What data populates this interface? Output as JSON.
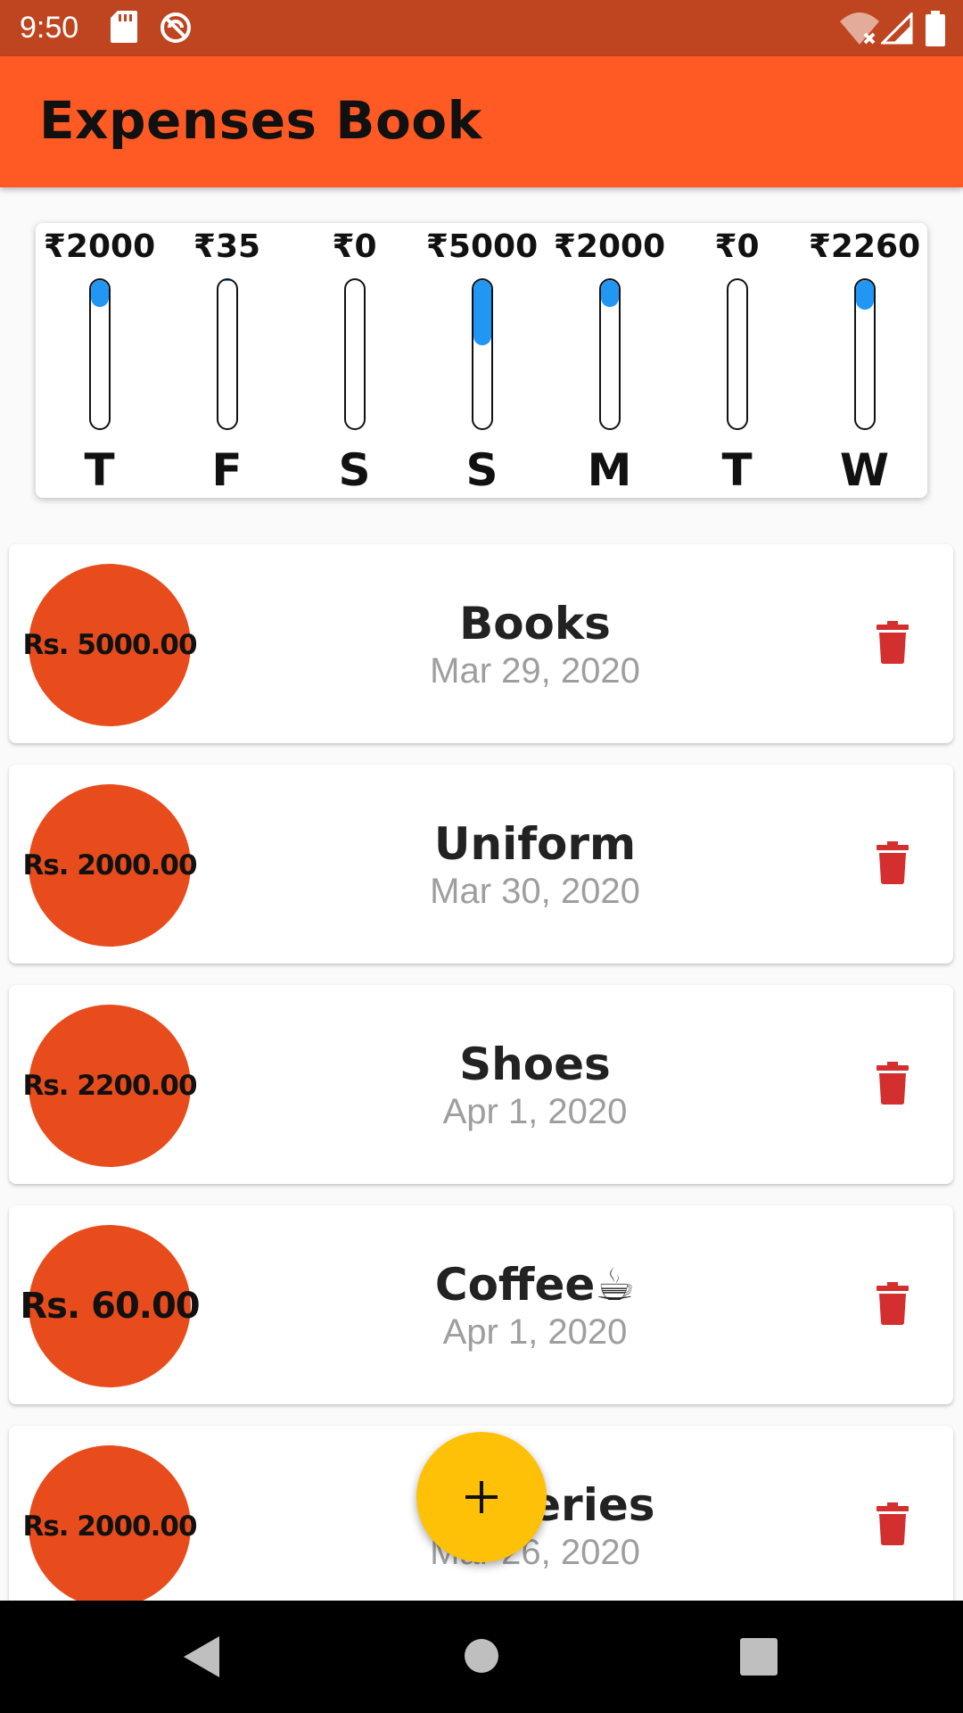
{
  "status_bar": {
    "time": "9:50",
    "icons": [
      "sd-card-icon",
      "sync-icon",
      "wifi-off-icon",
      "signal-icon",
      "battery-icon"
    ]
  },
  "app_bar": {
    "title": "Expenses Book",
    "color": "#ff5a24"
  },
  "chart_data": {
    "type": "bar",
    "categories": [
      "T",
      "F",
      "S",
      "S",
      "M",
      "T",
      "W"
    ],
    "labels": [
      "₹2000",
      "₹35",
      "₹0",
      "₹5000",
      "₹2000",
      "₹0",
      "₹2260"
    ],
    "values": [
      2000,
      35,
      0,
      5000,
      2000,
      0,
      2260
    ],
    "fraction_of_total": [
      0.18,
      0.003,
      0,
      0.44,
      0.18,
      0,
      0.2
    ],
    "bar_color": "#2196f3"
  },
  "transactions": [
    {
      "amount": "Rs. 5000.00",
      "title": "Books",
      "date": "Mar 29, 2020"
    },
    {
      "amount": "Rs. 2000.00",
      "title": "Uniform",
      "date": "Mar 30, 2020"
    },
    {
      "amount": "Rs. 2200.00",
      "title": "Shoes",
      "date": "Apr 1, 2020"
    },
    {
      "amount": "Rs. 60.00",
      "title": "Coffee☕",
      "date": "Apr 1, 2020"
    },
    {
      "amount": "Rs. 2000.00",
      "title": "Groceries",
      "date": "Mar 26, 2020"
    }
  ],
  "fab": {
    "icon": "plus-icon",
    "color": "#ffc107"
  },
  "nav_bar": {
    "icons": [
      "back-icon",
      "home-icon",
      "recents-icon"
    ]
  }
}
